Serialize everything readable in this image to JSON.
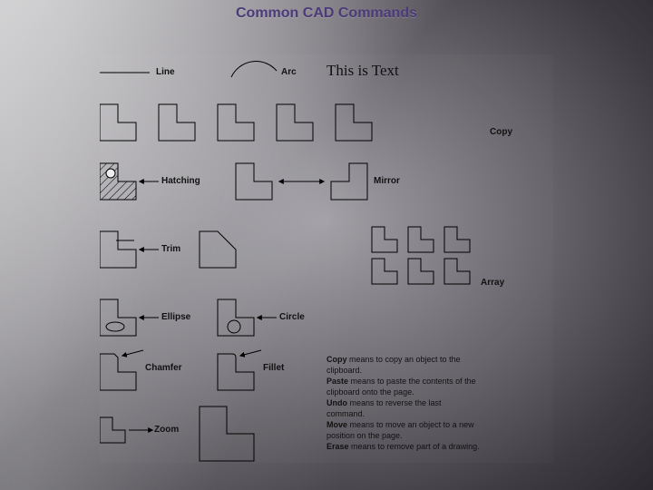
{
  "title": "Common CAD Commands",
  "labels": {
    "line": "Line",
    "arc": "Arc",
    "text_sample": "This is Text",
    "copy": "Copy",
    "hatching": "Hatching",
    "mirror": "Mirror",
    "trim": "Trim",
    "array": "Array",
    "ellipse": "Ellipse",
    "circle": "Circle",
    "chamfer": "Chamfer",
    "fillet": "Fillet",
    "zoom": "Zoom"
  },
  "desc": {
    "copy_b": "Copy",
    "copy_t": " means to copy an object to the clipboard.",
    "paste_b": "Paste",
    "paste_t": " means to paste the contents of the clipboard onto the page.",
    "undo_b": "Undo",
    "undo_t": " means to reverse the last command.",
    "move_b": "Move",
    "move_t": " means to move an object to a new position on the page.",
    "erase_b": "Erase",
    "erase_t": " means to remove part of a drawing."
  }
}
